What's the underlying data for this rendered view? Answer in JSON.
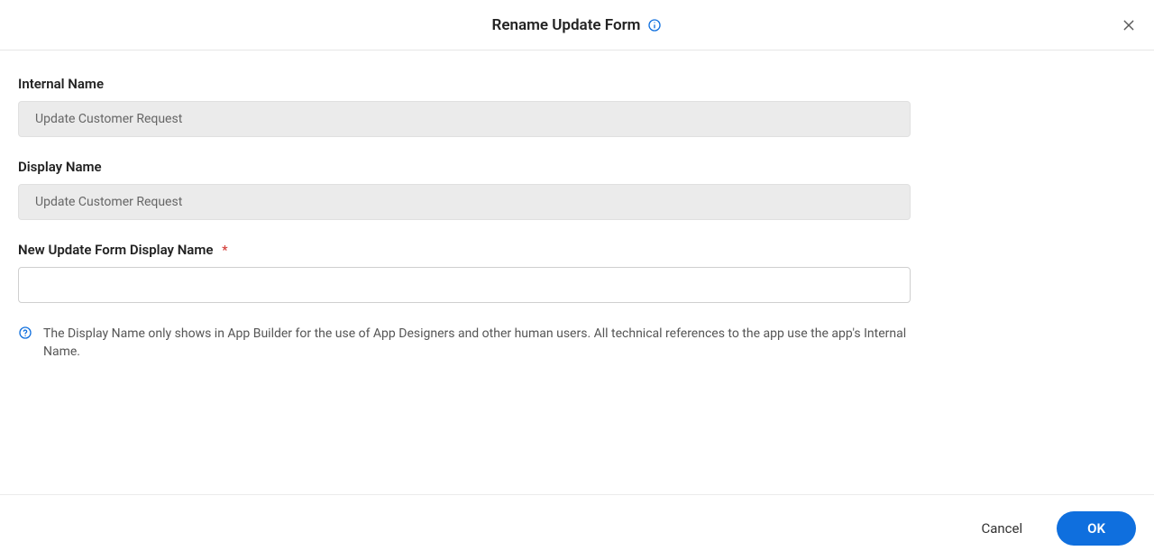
{
  "dialog": {
    "title": "Rename Update Form"
  },
  "form": {
    "internal_name": {
      "label": "Internal Name",
      "value": "Update Customer Request"
    },
    "display_name": {
      "label": "Display Name",
      "value": "Update Customer Request"
    },
    "new_display_name": {
      "label": "New Update Form Display Name",
      "required_mark": "*",
      "value": ""
    },
    "help_text": "The Display Name only shows in App Builder for the use of App Designers and other human users. All technical references to the app use the app's Internal Name."
  },
  "actions": {
    "cancel_label": "Cancel",
    "ok_label": "OK"
  }
}
